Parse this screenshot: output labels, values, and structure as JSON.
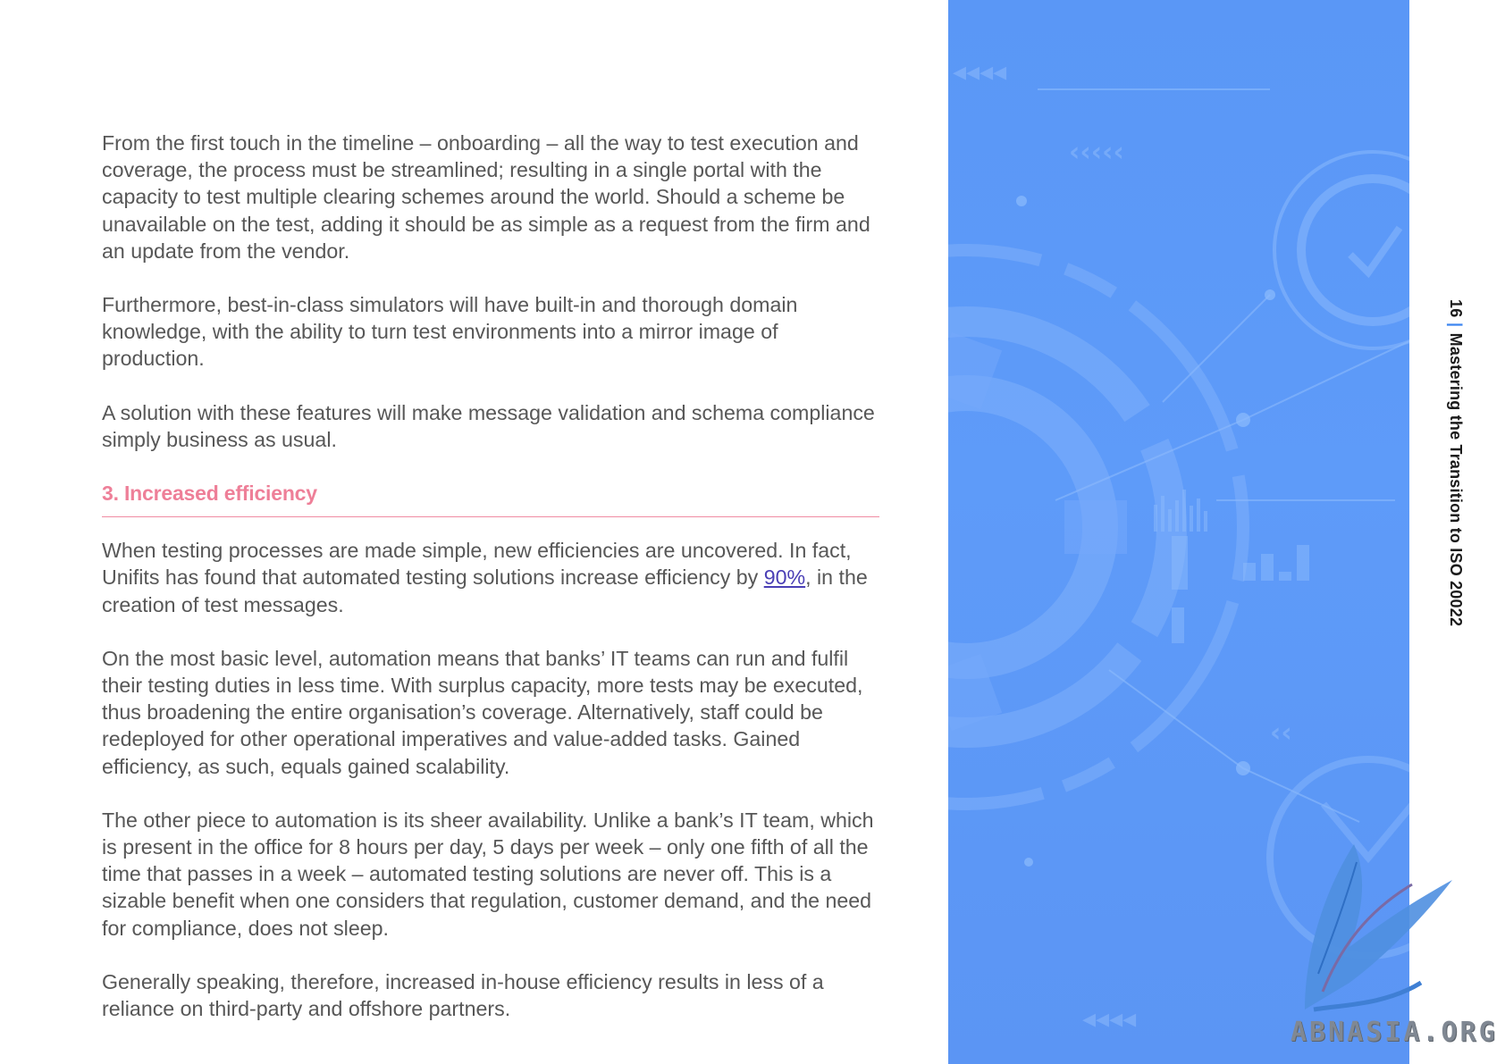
{
  "paragraphs_top": [
    "From the first touch in the timeline – onboarding – all the way to test execution and coverage, the process must be streamlined; resulting in a single portal with the capacity to test multiple clearing schemes around the world. Should a scheme be unavailable on the test, adding it should be as simple as a request from the firm and an update from the vendor.",
    "Furthermore, best-in-class simulators will have built-in and thorough domain knowledge, with the ability to turn test environments into a mirror image of production.",
    "A solution with these features will make message validation and schema compliance simply business as usual."
  ],
  "section": {
    "heading": "3. Increased efficiency",
    "para1_before_link": "When testing processes are made simple, new efficiencies are uncovered. In fact, Unifits has found that automated testing solutions increase efficiency by ",
    "para1_link": "90%",
    "para1_after_link": ", in the creation of test messages.",
    "paragraphs": [
      "On the most basic level, automation means that banks’ IT teams can run and fulfil their testing duties in less time. With surplus capacity, more tests may be executed, thus broadening the entire organisation’s coverage. Alternatively, staff could be redeployed for other operational imperatives and value-added tasks. Gained efficiency, as such, equals gained scalability.",
      "The other piece to automation is its sheer availability. Unlike a bank’s IT team, which is present in the office for 8 hours per day, 5 days per week – only one fifth of all the time that passes in a week – automated testing solutions are never off. This is a sizable benefit when one considers that regulation, customer demand, and the need for compliance, does not sleep.",
      "Generally speaking, therefore, increased in-house efficiency results in less of a reliance on third-party and offshore partners."
    ]
  },
  "sidebar": {
    "page_number": "16",
    "separator": "|",
    "document_title": "Mastering the Transition to ISO 20022"
  },
  "watermark": "ABNASIA.ORG",
  "colors": {
    "heading": "#ee7f98",
    "panel": "#5e9bf9",
    "link": "#4a3fb5",
    "body_text": "#575757"
  },
  "icons": [
    "gear-icon",
    "checkmark-gear-icon",
    "chevron-arrows-icon",
    "feather-lion-logo"
  ]
}
